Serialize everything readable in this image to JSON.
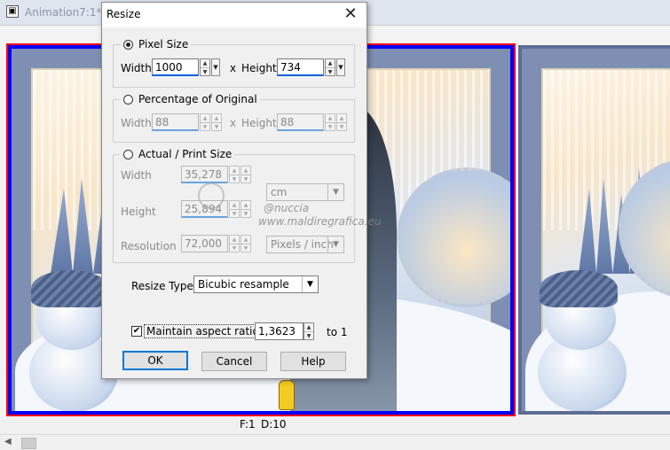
{
  "background_window": {
    "title": "Animation7:1* [",
    "watermark_top": "@nuccia",
    "watermark_url": "www.maldiregrafica.eu",
    "status": {
      "frame": "F:1",
      "duration": "D:10"
    },
    "colors": {
      "frame_border": "#5d6c93",
      "selection_outer": "#ff0000",
      "selection_inner": "#0000ff"
    }
  },
  "dialog": {
    "title": "Resize",
    "close_icon": "close-icon",
    "pixel_size": {
      "label": "Pixel Size",
      "selected": true,
      "width_label": "Width",
      "width_value": "1000",
      "x_label": "x",
      "height_label": "Height",
      "height_value": "734"
    },
    "percentage": {
      "label": "Percentage of Original",
      "selected": false,
      "width_label": "Width",
      "width_value": "88",
      "x_label": "x",
      "height_label": "Height",
      "height_value": "88"
    },
    "print_size": {
      "label": "Actual / Print Size",
      "selected": false,
      "width_label": "Width",
      "width_value": "35,278",
      "height_label": "Height",
      "height_value": "25,894",
      "resolution_label": "Resolution",
      "resolution_value": "72,000",
      "unit_value": "cm",
      "res_unit_value": "Pixels / inch"
    },
    "resize_type": {
      "label": "Resize Type",
      "value": "Bicubic resample"
    },
    "aspect": {
      "checked": true,
      "label": "Maintain aspect ratio of",
      "value": "1,3623",
      "suffix": "to 1"
    },
    "buttons": {
      "ok": "OK",
      "cancel": "Cancel",
      "help": "Help"
    }
  }
}
